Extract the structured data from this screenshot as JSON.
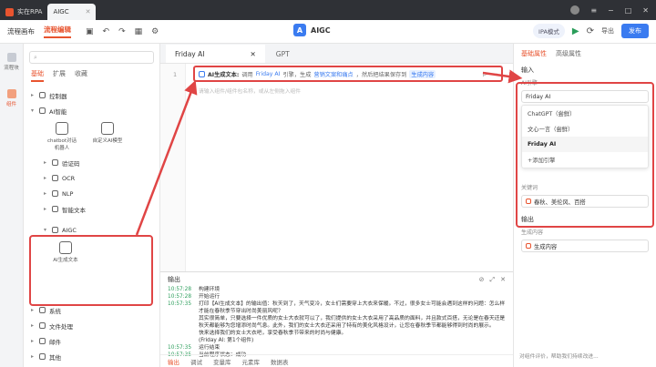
{
  "titlebar": {
    "tabs": [
      {
        "label": "实在RPA"
      },
      {
        "label": "AIGC"
      }
    ]
  },
  "toolbar": {
    "items": [
      {
        "label": "流程编辑"
      },
      {
        "label": "流程编辑"
      }
    ],
    "center_title": "AIGC",
    "ipa_label": "IPA模式",
    "export_label": "导出",
    "publish_label": "发布"
  },
  "leftnav": {
    "items": [
      {
        "label": "流程块"
      },
      {
        "label": "组件"
      }
    ]
  },
  "panel": {
    "search_placeholder": "",
    "tabs": [
      "基础",
      "扩展",
      "收藏"
    ],
    "tree": [
      {
        "label": "控制器",
        "level": 1
      },
      {
        "label": "AI智能",
        "level": 1,
        "expanded": true
      }
    ],
    "tiles": [
      {
        "label": "chatbot对话机器人"
      },
      {
        "label": "自定义AI模型"
      }
    ],
    "subtree": [
      {
        "label": "验证码"
      },
      {
        "label": "OCR"
      },
      {
        "label": "NLP"
      },
      {
        "label": "智能文本"
      }
    ],
    "aigc_group": {
      "label": "AIGC",
      "tile_label": "AI生成文本"
    },
    "bottom_tree": [
      {
        "label": "系统"
      },
      {
        "label": "文件处理"
      },
      {
        "label": "邮件"
      },
      {
        "label": "其他"
      }
    ]
  },
  "editor": {
    "tabs": [
      {
        "label": "Friday AI"
      },
      {
        "label": "GPT"
      }
    ],
    "line_number": "1",
    "step": {
      "name": "AI生成文本:",
      "seg1": "调用",
      "engine": "Friday AI",
      "seg2": "引擎，生成",
      "keywords": "营销文案和痛点",
      "seg3": "，然后把结果保存到",
      "output_var": "生成内容"
    },
    "hint": "请输入组件/组件包名称，或从左侧拖入组件"
  },
  "output": {
    "title": "输出",
    "log": [
      {
        "time": "10:57:28",
        "msg": "构建环境"
      },
      {
        "time": "10:57:28",
        "msg": "开始运行"
      },
      {
        "time": "10:57:35",
        "msg": "打印【AI生成文本】的输出值：秋天到了，天气变冷，女士们需要穿上大衣来保暖。不过，很多女士可能会遇到这样的问题：怎么样才能在春秋季节穿出时尚美丽风呢？"
      },
      {
        "time": "",
        "msg": "其实很简单，只要选择一件优质的女士大衣就可以了，我们提供的女士大衣采用了高品质的面料，并且款式百搭，无论是在春天还是秋天都能够为您增添时尚气息。此外，我们的女士大衣还采用了特有的美化风格设计，让您在春秋季节都能够得到时尚的展示。"
      },
      {
        "time": "",
        "msg": "快来选择我们的女士大衣吧，享受春秋季节带来的时尚与健康。"
      },
      {
        "time": "",
        "msg": "(Friday AI: 第1个组件)"
      },
      {
        "time": "10:57:35",
        "msg": "运行结束"
      },
      {
        "time": "10:57:35",
        "msg": "当前程序状态：成功"
      }
    ],
    "tabs": [
      "输出",
      "调试",
      "变量库",
      "元素库",
      "数据表"
    ]
  },
  "props": {
    "tabs": [
      "基础属性",
      "高级属性"
    ],
    "section_input": "输入",
    "ai_engine_label": "AI引擎",
    "ai_engine_value": "Friday AI",
    "options": [
      {
        "label": "ChatGPT（尝鲜）"
      },
      {
        "label": "文心一言（尝鲜）"
      },
      {
        "label": "Friday AI"
      },
      {
        "label": "+添加引擎"
      }
    ],
    "keywords_label": "关键词",
    "keywords_value": "春秋、美伦风、百搭",
    "section_output": "输出",
    "output_label": "生成内容",
    "output_value": "生成内容",
    "feedback": "对组件评价，帮助我们持续改进..."
  }
}
